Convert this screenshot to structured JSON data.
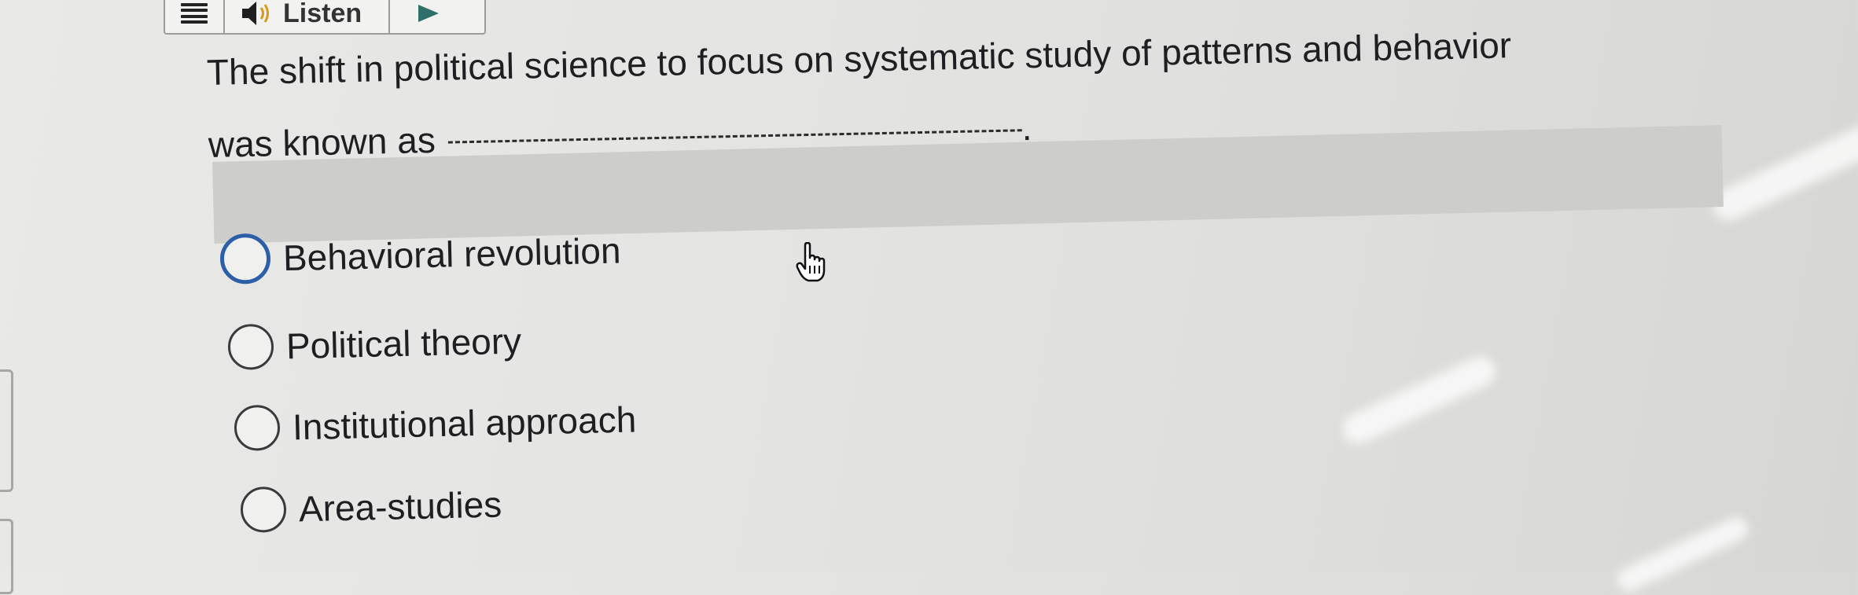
{
  "toolbar": {
    "menu_icon": "hamburger-menu-icon",
    "speaker_icon": "speaker-icon",
    "listen_label": "Listen",
    "play_icon": "play-icon"
  },
  "question": {
    "line1": "The shift in political science to focus on systematic study of patterns and behavior",
    "line2": "was known as",
    "end_mark": "."
  },
  "options": [
    {
      "label": "Behavioral revolution",
      "selected": false,
      "focused": true
    },
    {
      "label": "Political theory",
      "selected": false,
      "focused": false
    },
    {
      "label": "Institutional approach",
      "selected": false,
      "focused": false
    },
    {
      "label": "Area-studies",
      "selected": false,
      "focused": false
    }
  ],
  "colors": {
    "focus_ring": "#2d5fa8",
    "highlight_band": "#cdcdcb",
    "text": "#1f1f23"
  }
}
